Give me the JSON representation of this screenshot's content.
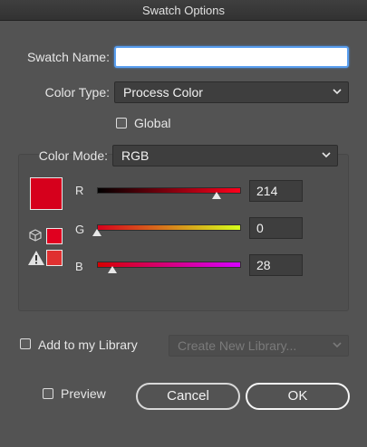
{
  "window": {
    "title": "Swatch Options"
  },
  "swatch_name": {
    "label": "Swatch Name:",
    "value": "",
    "placeholder": ""
  },
  "color_type": {
    "label": "Color Type:",
    "value": "Process Color"
  },
  "global": {
    "label": "Global",
    "checked": false
  },
  "color_mode": {
    "label": "Color Mode:",
    "value": "RGB"
  },
  "current_color": "#d6001c",
  "websafe_color": "#e0001f",
  "gamut_color": "#e03030",
  "channels": [
    {
      "label": "R",
      "value": "214",
      "level": 0.839
    },
    {
      "label": "G",
      "value": "0",
      "level": 0.0
    },
    {
      "label": "B",
      "value": "28",
      "level": 0.11
    }
  ],
  "library": {
    "label": "Add to my Library",
    "checked": false,
    "dropdown": "Create New Library..."
  },
  "preview": {
    "label": "Preview",
    "checked": false
  },
  "buttons": {
    "cancel": "Cancel",
    "ok": "OK"
  },
  "icons": {
    "websafe": "cube-icon",
    "gamut_warning": "warning-triangle-icon",
    "dropdown": "chevron-down-icon"
  }
}
